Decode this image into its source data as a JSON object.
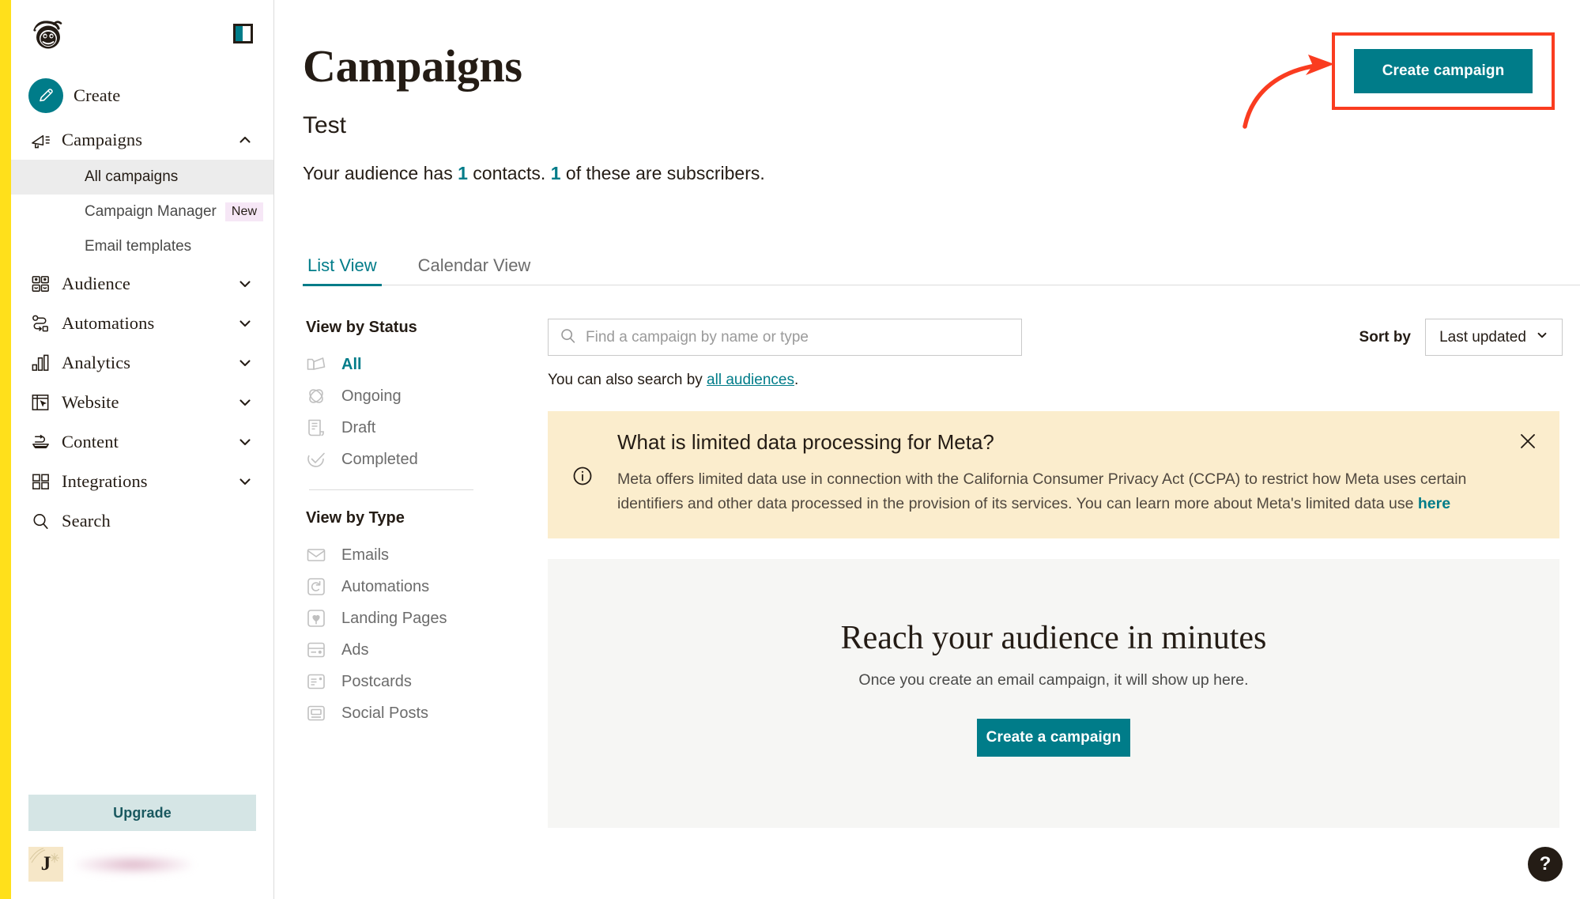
{
  "brand": {
    "logo_icon": "mailchimp-freddie-logo",
    "yellow": "#FFE01B",
    "teal": "#007C89",
    "annotation_red": "#FA3C20"
  },
  "sidebar": {
    "panel_toggle_icon": "panel-collapse-icon",
    "create": {
      "label": "Create",
      "icon": "pencil-icon"
    },
    "items": [
      {
        "label": "Campaigns",
        "icon": "megaphone-icon",
        "expanded": true,
        "chevron": "chevron-up-icon"
      },
      {
        "label": "Audience",
        "icon": "people-icon",
        "expanded": false,
        "chevron": "chevron-down-icon"
      },
      {
        "label": "Automations",
        "icon": "automation-path-icon",
        "expanded": false,
        "chevron": "chevron-down-icon"
      },
      {
        "label": "Analytics",
        "icon": "bar-chart-icon",
        "expanded": false,
        "chevron": "chevron-down-icon"
      },
      {
        "label": "Website",
        "icon": "website-layout-icon",
        "expanded": false,
        "chevron": "chevron-down-icon"
      },
      {
        "label": "Content",
        "icon": "content-stack-icon",
        "expanded": false,
        "chevron": "chevron-down-icon"
      },
      {
        "label": "Integrations",
        "icon": "grid-squares-icon",
        "expanded": false,
        "chevron": "chevron-down-icon"
      },
      {
        "label": "Search",
        "icon": "magnifier-icon",
        "expanded": false,
        "chevron": ""
      }
    ],
    "campaigns_subnav": [
      {
        "label": "All campaigns",
        "active": true,
        "badge": ""
      },
      {
        "label": "Campaign Manager",
        "active": false,
        "badge": "New"
      },
      {
        "label": "Email templates",
        "active": false,
        "badge": ""
      }
    ],
    "upgrade_label": "Upgrade",
    "account": {
      "avatar_initial": "J",
      "name_redacted": true
    }
  },
  "header": {
    "title": "Campaigns",
    "audience_name": "Test",
    "stats_prefix": "Your audience has ",
    "stats_contacts": "1",
    "stats_middle": " contacts. ",
    "stats_subscribers": "1",
    "stats_suffix": " of these are subscribers.",
    "create_campaign_label": "Create campaign"
  },
  "tabs": [
    {
      "label": "List View",
      "active": true
    },
    {
      "label": "Calendar View",
      "active": false
    }
  ],
  "filters": {
    "status_heading": "View by Status",
    "status_items": [
      {
        "label": "All",
        "icon": "all-campaigns-icon",
        "active": true
      },
      {
        "label": "Ongoing",
        "icon": "ongoing-atom-icon",
        "active": false
      },
      {
        "label": "Draft",
        "icon": "draft-document-icon",
        "active": false
      },
      {
        "label": "Completed",
        "icon": "completed-check-icon",
        "active": false
      }
    ],
    "type_heading": "View by Type",
    "type_items": [
      {
        "label": "Emails",
        "icon": "envelope-icon"
      },
      {
        "label": "Automations",
        "icon": "automation-refresh-icon"
      },
      {
        "label": "Landing Pages",
        "icon": "heart-page-icon"
      },
      {
        "label": "Ads",
        "icon": "ad-card-icon"
      },
      {
        "label": "Postcards",
        "icon": "postcard-icon"
      },
      {
        "label": "Social Posts",
        "icon": "social-post-icon"
      }
    ]
  },
  "search": {
    "icon": "search-icon",
    "placeholder": "Find a campaign by name or type",
    "value": "",
    "hint_prefix": "You can also search by ",
    "hint_link": "all audiences",
    "hint_suffix": "."
  },
  "sort": {
    "label": "Sort by",
    "value": "Last updated",
    "chevron": "chevron-down-icon"
  },
  "banner": {
    "icon": "info-circle-icon",
    "title": "What is limited data processing for Meta?",
    "body_before_link": "Meta offers limited data use in connection with the California Consumer Privacy Act (CCPA) to restrict how Meta uses certain identifiers and other data processed in the provision of its services. You can learn more about Meta's limited data use ",
    "body_link": "here",
    "close_icon": "close-icon"
  },
  "empty_state": {
    "title": "Reach your audience in minutes",
    "subtitle": "Once you create an email campaign, it will show up here.",
    "button_label": "Create a campaign"
  },
  "help": {
    "label": "?",
    "icon": "help-question-icon"
  }
}
